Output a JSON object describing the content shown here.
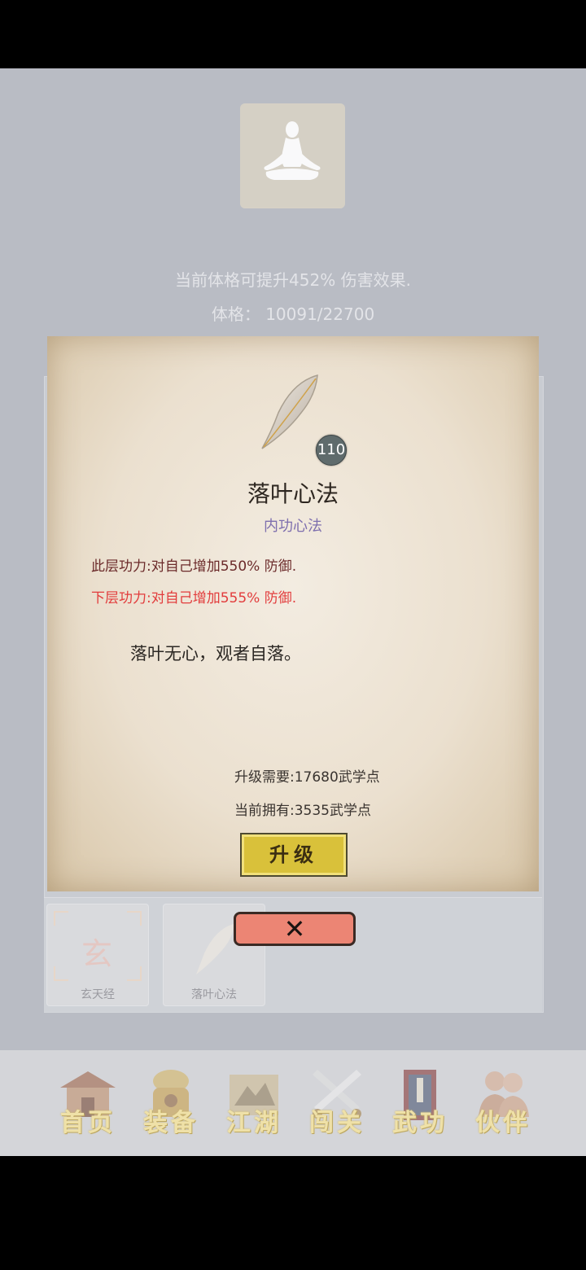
{
  "header": {
    "boost_text": "当前体格可提升452% 伤害效果.",
    "physique_label": "体格：",
    "physique_value": "10091/22700"
  },
  "modal": {
    "level": "110",
    "skill_name": "落叶心法",
    "skill_type": "内功心法",
    "current_layer": "此层功力:对自己增加550% 防御.",
    "next_layer": "下层功力:对自己增加555% 防御.",
    "description": "落叶无心，观者自落。",
    "upgrade_need": "升级需要:17680武学点",
    "current_owned": "当前拥有:3535武学点",
    "upgrade_button": "升级",
    "close_button": "✕"
  },
  "skill_list": [
    {
      "label": "玄天经",
      "glyph": "玄"
    },
    {
      "label": "落叶心法"
    }
  ],
  "nav": [
    {
      "label": "首页",
      "icon": "house-icon"
    },
    {
      "label": "装备",
      "icon": "armor-icon"
    },
    {
      "label": "江湖",
      "icon": "scroll-map-icon"
    },
    {
      "label": "闯关",
      "icon": "crossed-swords-icon"
    },
    {
      "label": "武功",
      "icon": "book-icon"
    },
    {
      "label": "伙伴",
      "icon": "companions-icon"
    }
  ],
  "colors": {
    "next_layer": "#e23c3c",
    "current_layer": "#6b2a2a",
    "skill_type": "#7e6fae",
    "upgrade_button": "#d9c13a",
    "close_button": "#ec8574"
  }
}
